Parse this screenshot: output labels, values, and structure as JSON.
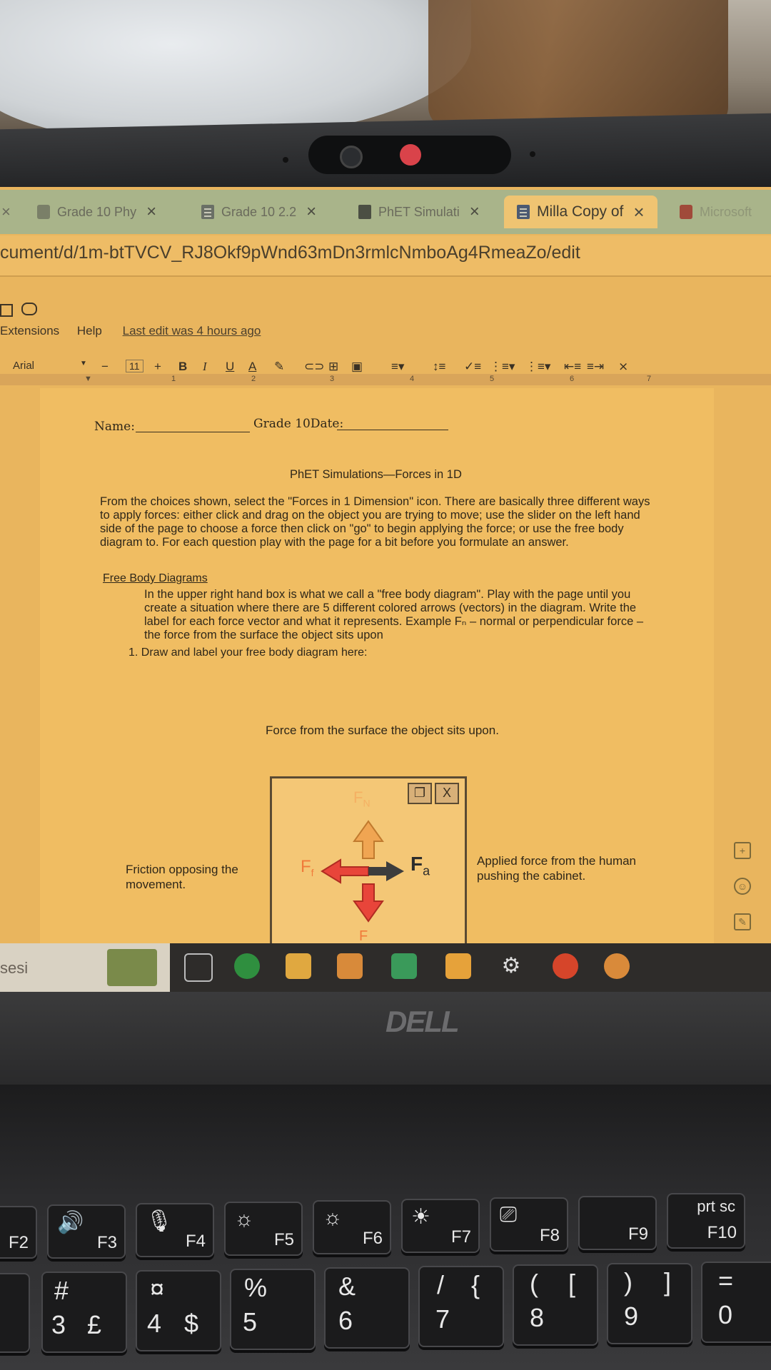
{
  "browser": {
    "tabs": [
      {
        "label": "Grade 10 Phy",
        "close": "×"
      },
      {
        "label": "Grade 10 2.2",
        "close": "×"
      },
      {
        "label": "PhET Simulati",
        "close": "×"
      },
      {
        "label": "Milla Copy of",
        "close": "×",
        "active": true
      },
      {
        "label": "Microsoft"
      }
    ],
    "tab_close_left": "×",
    "url": "cument/d/1m-btTVCV_RJ8Okf9pWnd63mDn3rmlcNmboAg4RmeaZo/edit"
  },
  "docs": {
    "menu": {
      "extensions": "Extensions",
      "help": "Help",
      "last_edit": "Last edit was 4 hours ago"
    },
    "toolbar": {
      "font": "Arial",
      "minus": "−",
      "font_size": "11",
      "plus": "+",
      "bold": "B",
      "italic": "I",
      "underline": "U",
      "text_color": "A"
    },
    "ruler": [
      "1",
      "2",
      "3",
      "4",
      "5",
      "6",
      "7"
    ]
  },
  "document": {
    "name_label": "Name:",
    "grade_label": "Grade 10Date:",
    "title": "PhET Simulations—Forces in 1D",
    "intro": "From the choices shown, select the \"Forces in 1 Dimension\" icon. There are basically three different ways to apply forces: either click and drag on the object you are trying to move; use the slider on the left hand side of the page to choose a force then click on \"go\" to begin applying the force; or use the free body diagram to. For each question play with the page for a bit before you formulate an answer.",
    "section_heading": "Free Body Diagrams",
    "section_text": "In the upper right hand box is what we call a \"free body diagram\". Play with the page until you create a situation where there are 5 different colored arrows (vectors) in the diagram. Write the label for each force vector and what it represents. Example Fₙ – normal or perpendicular force – the force from the surface the object sits upon",
    "question_1": "1.  Draw and label your free body diagram here:",
    "annotation_normal": "Force from the surface the object sits upon.",
    "annotation_friction": "Friction opposing the movement.",
    "annotation_applied": "Applied force from the human pushing the cabinet.",
    "fbd": {
      "label_normal": "F",
      "label_normal_sub": "N",
      "label_friction": "F",
      "label_friction_sub": "f",
      "label_applied": "F",
      "label_applied_sub": "a",
      "label_gravity": "F",
      "btn_restore": "❐",
      "btn_close": "X"
    }
  },
  "taskbar": {
    "search_text": "sesi"
  },
  "laptop": {
    "brand": "DELL"
  },
  "keyboard": {
    "fkeys": [
      {
        "label": "F2"
      },
      {
        "label": "F3",
        "icon": "speaker-icon"
      },
      {
        "label": "F4",
        "icon": "mic-mute-icon"
      },
      {
        "label": "F5",
        "icon": "brightness-low-icon"
      },
      {
        "label": "F6",
        "icon": "brightness-down-icon"
      },
      {
        "label": "F7",
        "icon": "brightness-up-icon"
      },
      {
        "label": "F8",
        "icon": "display-icon"
      },
      {
        "label": "F9"
      },
      {
        "label": "prt sc",
        "sub": "F10"
      }
    ],
    "numkeys": [
      {
        "top": "#",
        "bottom": "3",
        "alt": "£"
      },
      {
        "top": "¤",
        "bottom": "4",
        "alt": "$"
      },
      {
        "top": "%",
        "bottom": "5"
      },
      {
        "top": "&",
        "bottom": "6"
      },
      {
        "top": "/",
        "bottom": "7",
        "alt": "{"
      },
      {
        "top": "(",
        "bottom": "8",
        "alt": "["
      },
      {
        "top": ")",
        "bottom": "9",
        "alt": "]"
      },
      {
        "top": "=",
        "bottom": "0"
      }
    ]
  },
  "colors": {
    "screen_bg": "#e9b55e",
    "tab_active": "#efc472",
    "fbd_normal": "#f0a552",
    "fbd_friction": "#e8453a",
    "fbd_applied": "#3d3d3d"
  }
}
